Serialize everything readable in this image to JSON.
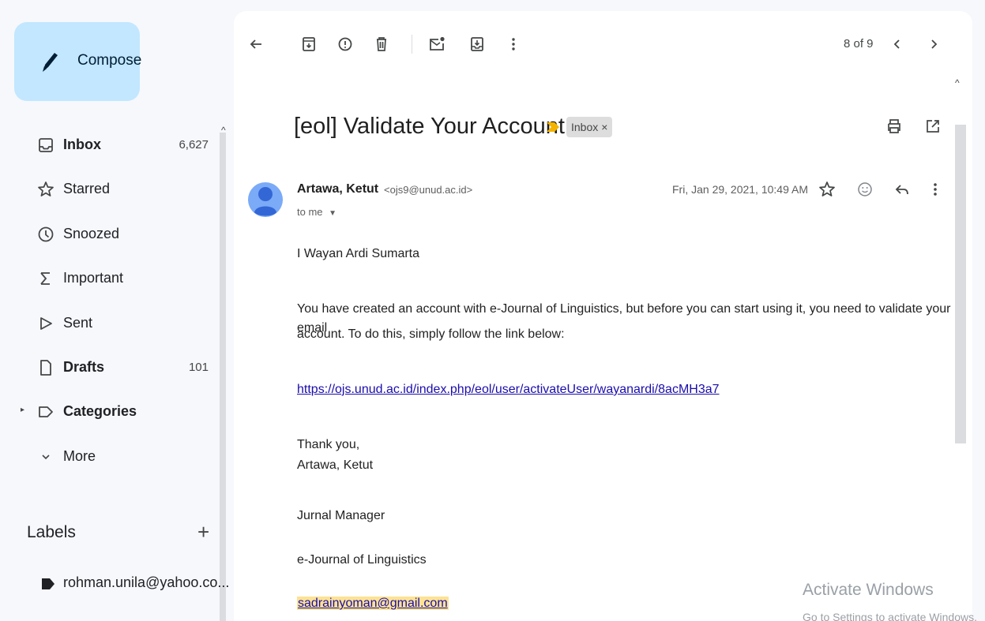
{
  "compose": {
    "label": "Compose",
    "icon": "pencil-icon"
  },
  "nav": [
    {
      "label": "Inbox",
      "count": "6,627",
      "bold": true,
      "icon": "inbox-icon"
    },
    {
      "label": "Starred",
      "count": "",
      "bold": false,
      "icon": "star-icon"
    },
    {
      "label": "Snoozed",
      "count": "",
      "bold": false,
      "icon": "clock-icon"
    },
    {
      "label": "Important",
      "count": "",
      "bold": false,
      "icon": "important-icon"
    },
    {
      "label": "Sent",
      "count": "",
      "bold": false,
      "icon": "send-icon"
    },
    {
      "label": "Drafts",
      "count": "101",
      "bold": true,
      "icon": "draft-icon"
    },
    {
      "label": "Categories",
      "count": "",
      "bold": true,
      "icon": "label-outline-icon"
    },
    {
      "label": "More",
      "count": "",
      "bold": false,
      "icon": "chevron-down-icon"
    }
  ],
  "labels": {
    "heading": "Labels",
    "add": "+",
    "items": [
      {
        "label": "rohman.unila@yahoo.co..."
      }
    ]
  },
  "toolbar": {
    "page_count": "8 of 9"
  },
  "message": {
    "subject": "[eol] Validate Your Account",
    "chip": "Inbox",
    "chip_close": "×",
    "sender_name": "Artawa, Ketut",
    "sender_email": "<ojs9@unud.ac.id>",
    "to": "to me",
    "date": "Fri, Jan 29, 2021, 10:49 AM",
    "greeting": "I Wayan Ardi Sumarta",
    "para1_line1": "You have created an account with e-Journal of Linguistics, but before you can start using it, you need to validate your email",
    "para1_line2": "account. To do this, simply follow the link below:",
    "link": "https://ojs.unud.ac.id/index.php/eol/user/activateUser/wayanardi/8acMH3a7",
    "thanks": "Thank you,",
    "signature": "Artawa, Ketut",
    "role": "Jurnal Manager",
    "org": "e-Journal of Linguistics",
    "highlight_email": "sadrainyoman@gmail.com"
  },
  "watermark": {
    "title": "Activate Windows",
    "subtitle": "Go to Settings to activate Windows."
  },
  "colors": {
    "compose_bg": "#c2e7ff",
    "page_bg": "#f6f8fc",
    "link": "#1a0dab",
    "highlight": "#fde293",
    "important_marker": "#f4b400",
    "avatar": "#7baaf7"
  }
}
